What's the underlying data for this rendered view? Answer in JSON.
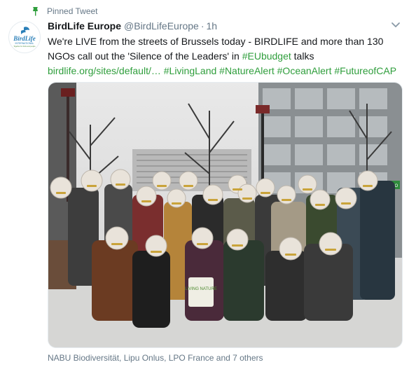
{
  "pinned": {
    "label": "Pinned Tweet"
  },
  "author": {
    "name": "BirdLife Europe",
    "handle": "@BirdLifeEurope",
    "time": "1h",
    "separator": "·",
    "avatar": {
      "logo_text": "BirdLife",
      "sub_text": "INTERNATIONAL",
      "tagline": "Together for birds and people"
    }
  },
  "tweet": {
    "text_1": "We're LIVE from the streets of Brussels today - BIRDLIFE and more than 130 NGOs call out the 'Silence of the Leaders' in ",
    "hashtag_eubudget": "#EUbudget",
    "text_2": " talks ",
    "link": "birdlife.org/sites/default/…",
    "text_3": " ",
    "hashtag_livingland": "#LivingLand",
    "hashtag_naturealert": "#NatureAlert",
    "hashtag_oceanalert": "#OceanAlert",
    "hashtag_futureofcap": "#FutureofCAP",
    "space": " "
  },
  "media": {
    "bag_text": "LIVING NATURE",
    "door_sign": "BIO"
  },
  "tagged_line": "NABU Biodiversität, Lipu Onlus, LPO France and 7 others",
  "colors": {
    "link": "#2f9e3c",
    "secondary_text": "#657786",
    "pin": "#2f9e3c",
    "logo_blue": "#2a7fb8"
  },
  "icons": {
    "pin": "pin-icon",
    "caret": "chevron-down-icon"
  }
}
